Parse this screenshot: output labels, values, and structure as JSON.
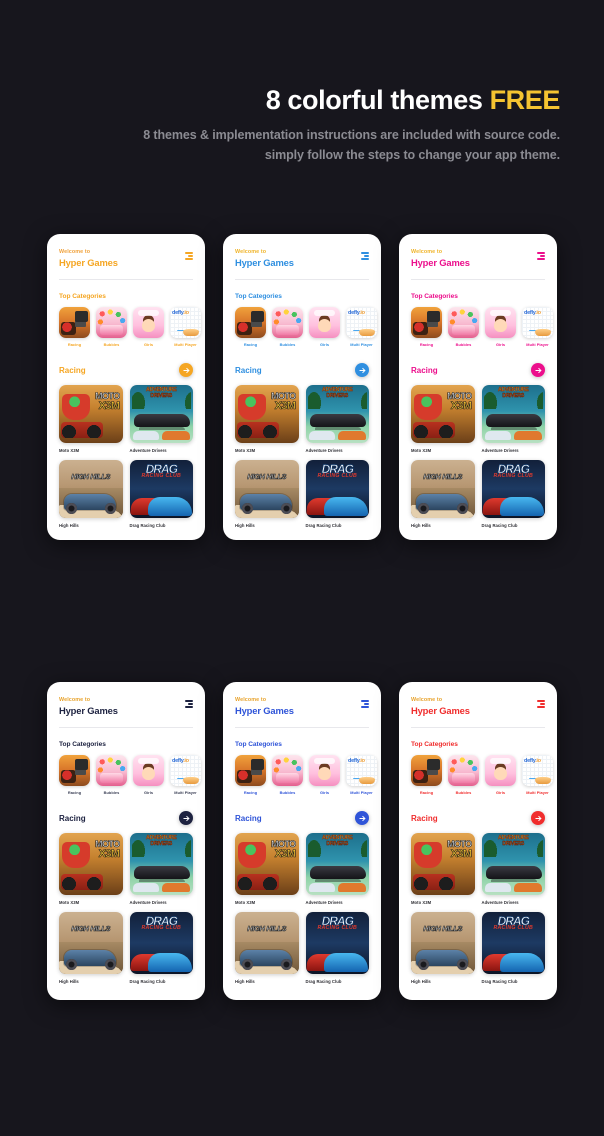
{
  "hero": {
    "title_main": "8 colorful themes ",
    "title_accent": "FREE",
    "sub_line1": "8 themes & implementation instructions are included with source code.",
    "sub_line2": "simply follow the steps to change your app theme.",
    "accent_color": "#f5c431",
    "background": "#17161d"
  },
  "app": {
    "welcome_label": "Welcome to",
    "brand_name": "Hyper Games",
    "categories_title": "Top Categories",
    "racing_title": "Racing",
    "menu_icon": "hamburger-icon",
    "arrow_icon": "arrow-right-icon",
    "categories": [
      {
        "label": "Racing",
        "art": "art-racing"
      },
      {
        "label": "Bubbles",
        "art": "art-bubbles"
      },
      {
        "label": "Girls",
        "art": "art-girls"
      },
      {
        "label": "Multi Player",
        "art": "art-defly"
      }
    ],
    "defly_logo": {
      "main": "defly",
      "suffix": ".io"
    },
    "games": [
      {
        "name": "Moto X3M",
        "art": "g-moto",
        "logo_top": "MOTO",
        "logo_bottom": "X3M"
      },
      {
        "name": "Adventure Drivers",
        "art": "g-adv",
        "logo_top": "ADVENTURE",
        "logo_bottom": "DRIVERS"
      },
      {
        "name": "High Hills",
        "art": "g-hills",
        "logo_top": "HIGH HILLS",
        "logo_bottom": ""
      },
      {
        "name": "Drag Racing Club",
        "art": "g-drag",
        "logo_top": "DRAG",
        "logo_bottom": "RACING CLUB"
      }
    ]
  },
  "themes": [
    {
      "id": "theme-orange",
      "welcome": "#f0a23c",
      "brand": "#f5a623",
      "section": "#f5a623",
      "cat_label": "#f5a623",
      "accent": "#f5a623",
      "menu": "#f5a623",
      "card_bg": "#ffffff"
    },
    {
      "id": "theme-blue",
      "welcome": "#f0b429",
      "brand": "#2f8fe0",
      "section": "#2f8fe0",
      "cat_label": "#2f8fe0",
      "accent": "#2f8fe0",
      "menu": "#2f8fe0",
      "card_bg": "#ffffff"
    },
    {
      "id": "theme-pink",
      "welcome": "#f0b429",
      "brand": "#ec0f8c",
      "section": "#ec0f8c",
      "cat_label": "#ec0f8c",
      "accent": "#ec0f8c",
      "menu": "#ec0f8c",
      "card_bg": "#ffffff"
    },
    {
      "id": "theme-navy",
      "welcome": "#e8a32c",
      "brand": "#1d2240",
      "section": "#1d2240",
      "cat_label": "#3a3f55",
      "accent": "#1d2240",
      "menu": "#1d2240",
      "card_bg": "#ffffff"
    },
    {
      "id": "theme-indigo",
      "welcome": "#e8a32c",
      "brand": "#2f54d8",
      "section": "#2f54d8",
      "cat_label": "#2f54d8",
      "accent": "#2f54d8",
      "menu": "#2f54d8",
      "card_bg": "#ffffff"
    },
    {
      "id": "theme-red",
      "welcome": "#e8a32c",
      "brand": "#f02d2d",
      "section": "#f02d2d",
      "cat_label": "#f02d2d",
      "accent": "#f02d2d",
      "menu": "#f02d2d",
      "card_bg": "#ffffff"
    }
  ]
}
